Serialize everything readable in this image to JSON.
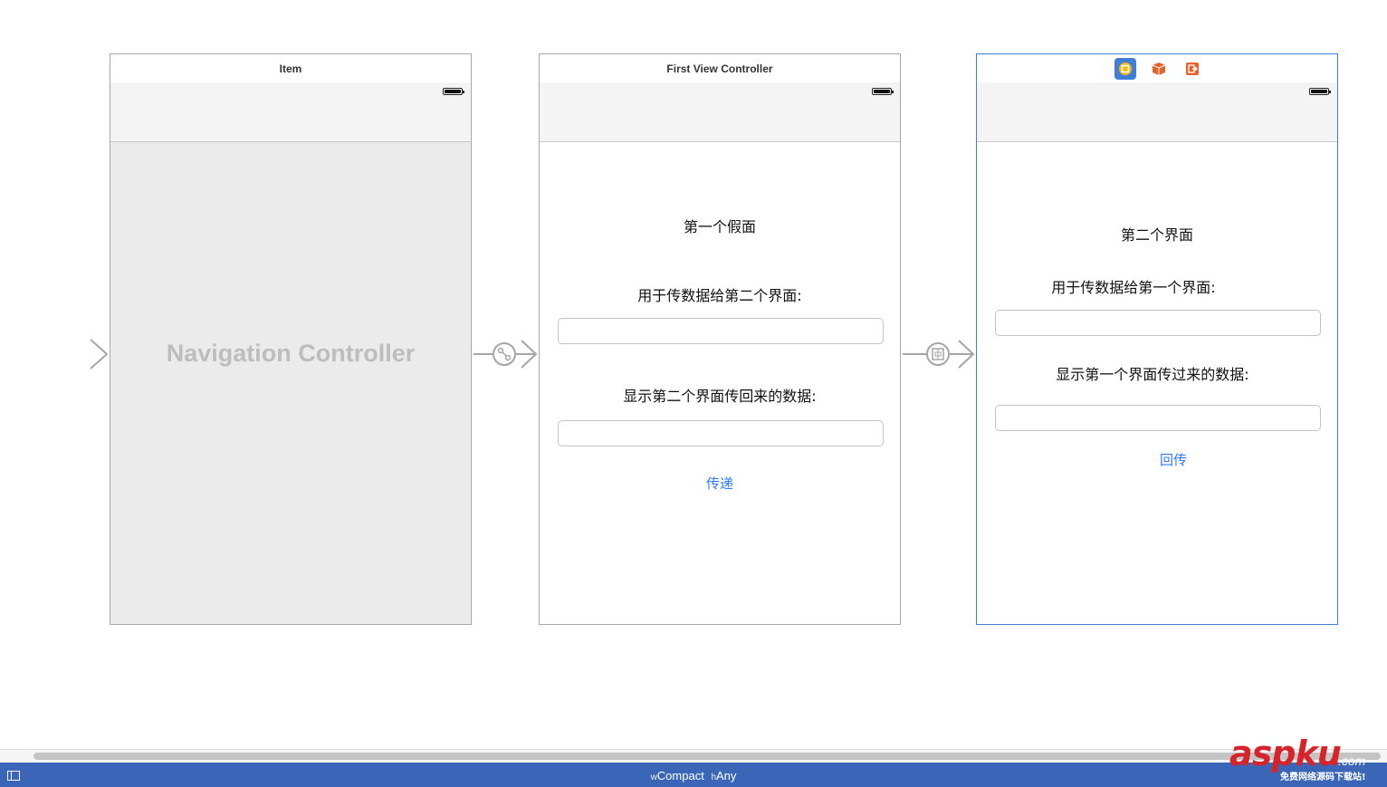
{
  "scenes": {
    "navigation": {
      "title": "Item",
      "placeholder_title": "Navigation Controller"
    },
    "first": {
      "title": "First View Controller",
      "heading": "第一个假面",
      "send_label": "用于传数据给第二个界面:",
      "display_label": "显示第二个界面传回来的数据:",
      "action_button": "传递"
    },
    "second": {
      "dock_icons": [
        "view-controller-icon",
        "first-responder-icon",
        "exit-icon"
      ],
      "heading": "第二个界面",
      "send_label": "用于传数据给第一个界面:",
      "display_label": "显示第一个界面传过来的数据:",
      "action_button": "回传"
    }
  },
  "segues": [
    "root-relationship-segue-icon",
    "show-segue-icon",
    "present-segue-icon"
  ],
  "size_class": {
    "w_prefix": "w",
    "w_value": "Compact",
    "h_prefix": "h",
    "h_value": "Any"
  },
  "watermark": {
    "main": "asp",
    "second": "ku",
    "suffix": ".com",
    "subtitle": "免费网络源码下载站!"
  },
  "colors": {
    "selection_blue": "#3f7fd9",
    "link_blue": "#2f7bf5",
    "status_bar": "#3b66b8",
    "dock_yellow": "#f5b915",
    "dock_orange": "#e8622b"
  }
}
